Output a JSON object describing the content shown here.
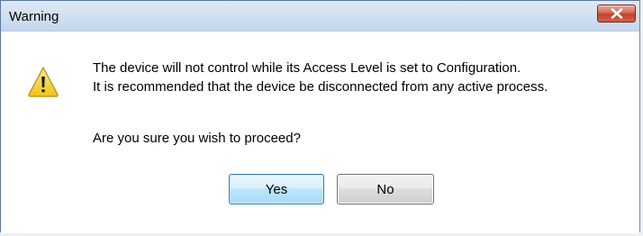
{
  "window": {
    "title": "Warning"
  },
  "icons": {
    "close": "close-icon",
    "warning": "warning-icon"
  },
  "message": {
    "line1": "The device will not control while its Access Level is set to Configuration.",
    "line2": "It is recommended that the device be disconnected from any active process.",
    "question": "Are you sure you wish to proceed?"
  },
  "buttons": {
    "yes_label": "Yes",
    "no_label": "No"
  },
  "colors": {
    "close_button": "#c7452f",
    "warning_fill": "#f5d327",
    "default_button_border": "#3c7fb1"
  }
}
